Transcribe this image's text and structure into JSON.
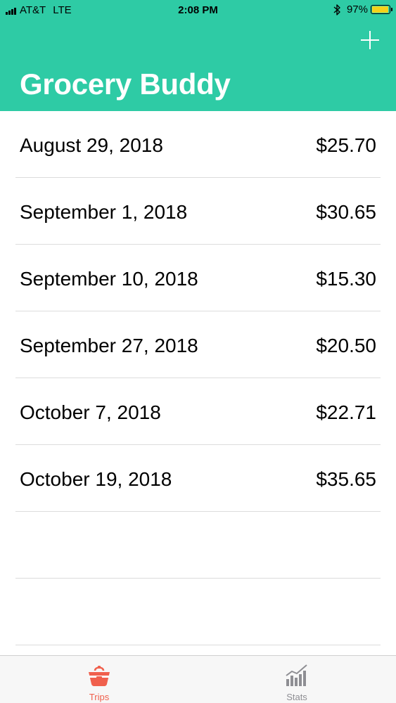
{
  "status_bar": {
    "carrier": "AT&T",
    "network": "LTE",
    "time": "2:08 PM",
    "battery_percent": "97%",
    "battery_color": "#f4d21c"
  },
  "header": {
    "title": "Grocery Buddy",
    "background_color": "#2ecba5",
    "add_icon": "plus-icon"
  },
  "trips": [
    {
      "date": "August 29, 2018",
      "amount": "$25.70"
    },
    {
      "date": "September 1, 2018",
      "amount": "$30.65"
    },
    {
      "date": "September 10, 2018",
      "amount": "$15.30"
    },
    {
      "date": "September 27, 2018",
      "amount": "$20.50"
    },
    {
      "date": "October 7, 2018",
      "amount": "$22.71"
    },
    {
      "date": "October 19, 2018",
      "amount": "$35.65"
    }
  ],
  "tab_bar": {
    "tabs": [
      {
        "label": "Trips",
        "icon": "basket-icon",
        "selected": true,
        "color": "#f0604d"
      },
      {
        "label": "Stats",
        "icon": "bar-chart-icon",
        "selected": false,
        "color": "#8e8e93"
      }
    ]
  }
}
